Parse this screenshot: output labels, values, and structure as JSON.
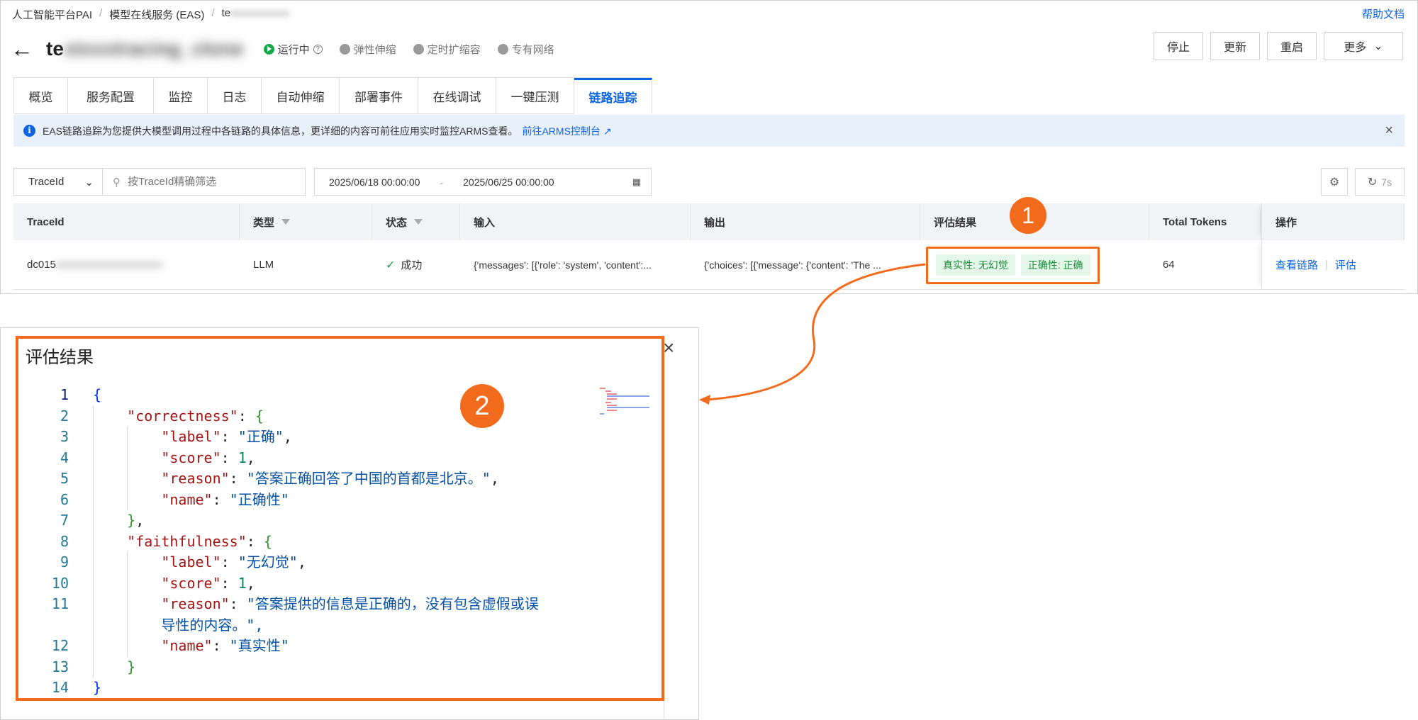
{
  "breadcrumb": {
    "items": [
      "人工智能平台PAI",
      "模型在线服务 (EAS)",
      "te"
    ],
    "redacted_tail": "xxxxxxxxxxx"
  },
  "help_link": "帮助文档",
  "service": {
    "name_visible": "te",
    "name_redacted": "xtxxxtracing_clone",
    "status_running": "运行中",
    "badges": [
      "弹性伸缩",
      "定时扩缩容",
      "专有网络"
    ]
  },
  "actions": {
    "stop": "停止",
    "update": "更新",
    "restart": "重启",
    "more": "更多"
  },
  "tabs": [
    "概览",
    "服务配置",
    "监控",
    "日志",
    "自动伸缩",
    "部署事件",
    "在线调试",
    "一键压测",
    "链路追踪"
  ],
  "active_tab": "链路追踪",
  "notice": {
    "text": "EAS链路追踪为您提供大模型调用过程中各链路的具体信息，更详细的内容可前往应用实时监控ARMS查看。",
    "link": "前往ARMS控制台",
    "close": "×"
  },
  "filter": {
    "field_select": "TraceId",
    "search_placeholder": "按TraceId精确筛选",
    "date_start": "2025/06/18 00:00:00",
    "date_separator": "-",
    "date_end": "2025/06/25 00:00:00",
    "refresh_label": "7s"
  },
  "table": {
    "headers": [
      "TraceId",
      "类型",
      "状态",
      "输入",
      "输出",
      "评估结果",
      "Total Tokens",
      "操作"
    ],
    "rows": [
      {
        "trace_id_visible": "dc015",
        "trace_id_redacted": "xxxxxxxxxxxxxxxxxxxx",
        "type": "LLM",
        "status": "成功",
        "input": "{'messages': [{'role': 'system', 'content':...",
        "output": "{'choices': [{'message': {'content': 'The ...",
        "eval_badges": [
          "真实性: 无幻觉",
          "正确性: 正确"
        ],
        "total_tokens": "64",
        "ops": [
          "查看链路",
          "评估"
        ]
      }
    ]
  },
  "markers": [
    "1",
    "2"
  ],
  "dialog": {
    "title": "评估结果",
    "close": "×",
    "code_lines": [
      {
        "n": "1",
        "text": "{"
      },
      {
        "n": "2",
        "text": "    \"correctness\": {"
      },
      {
        "n": "3",
        "text": "        \"label\": \"正确\","
      },
      {
        "n": "4",
        "text": "        \"score\": 1,"
      },
      {
        "n": "5",
        "text": "        \"reason\": \"答案正确回答了中国的首都是北京。\","
      },
      {
        "n": "6",
        "text": "        \"name\": \"正确性\""
      },
      {
        "n": "7",
        "text": "    },"
      },
      {
        "n": "8",
        "text": "    \"faithfulness\": {"
      },
      {
        "n": "9",
        "text": "        \"label\": \"无幻觉\","
      },
      {
        "n": "10",
        "text": "        \"score\": 1,"
      },
      {
        "n": "11",
        "text": "        \"reason\": \"答案提供的信息是正确的，没有包含虚假或误"
      },
      {
        "n": "",
        "text": "        导性的内容。\","
      },
      {
        "n": "12",
        "text": "        \"name\": \"真实性\""
      },
      {
        "n": "13",
        "text": "    }"
      },
      {
        "n": "14",
        "text": "}"
      }
    ]
  },
  "colors": {
    "accent": "#0b64e4",
    "highlight": "#f26b1d",
    "success": "#1aa34a",
    "badge_bg": "#e5f7e9",
    "notice_bg": "#e8f0fc"
  }
}
